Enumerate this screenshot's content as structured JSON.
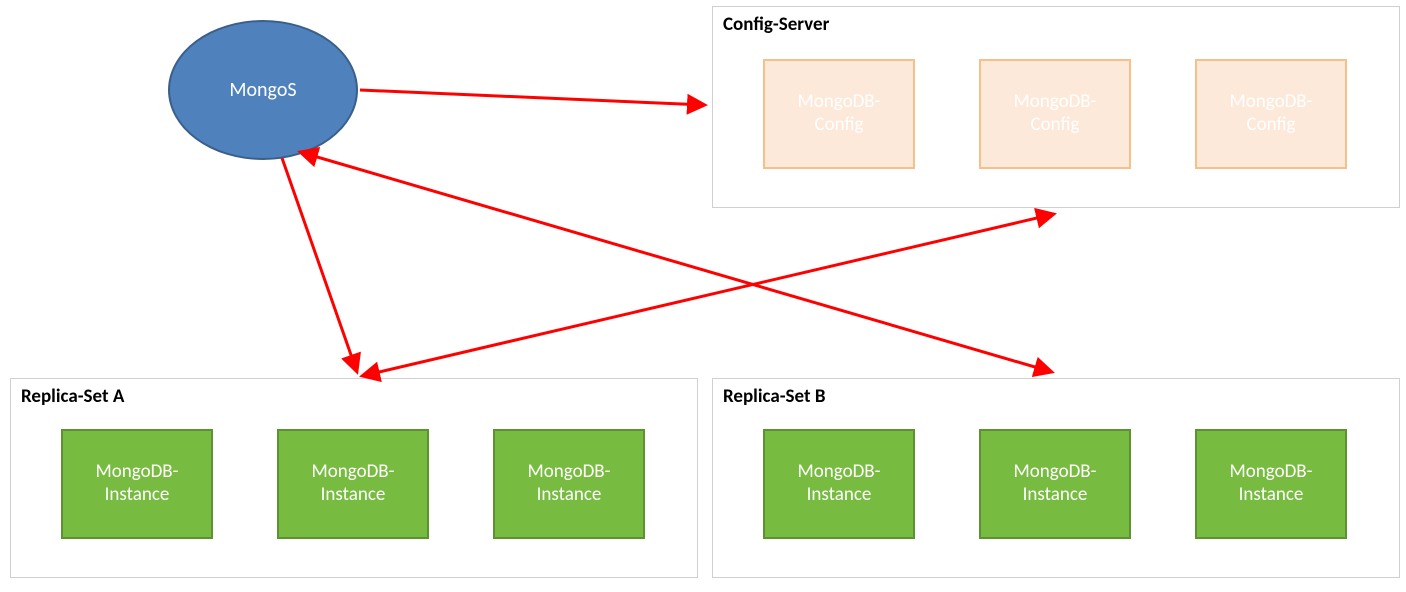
{
  "router": {
    "label": "MongoS"
  },
  "config_server": {
    "title": "Config-Server",
    "nodes": [
      {
        "label": "MongoDB-\nConfig"
      },
      {
        "label": "MongoDB-\nConfig"
      },
      {
        "label": "MongoDB-\nConfig"
      }
    ]
  },
  "replica_sets": [
    {
      "title": "Replica-Set A",
      "nodes": [
        {
          "label": "MongoDB-\nInstance"
        },
        {
          "label": "MongoDB-\nInstance"
        },
        {
          "label": "MongoDB-\nInstance"
        }
      ]
    },
    {
      "title": "Replica-Set B",
      "nodes": [
        {
          "label": "MongoDB-\nInstance"
        },
        {
          "label": "MongoDB-\nInstance"
        },
        {
          "label": "MongoDB-\nInstance"
        }
      ]
    }
  ],
  "arrows": {
    "color": "#ff0000",
    "edges": [
      {
        "from": "mongos",
        "to": "config-server",
        "direction": "uni"
      },
      {
        "from": "mongos",
        "to": "replica-set-a",
        "direction": "uni"
      },
      {
        "from": "mongos",
        "to": "replica-set-b",
        "direction": "bi"
      },
      {
        "from": "replica-set-a",
        "to": "config-server",
        "direction": "bi"
      }
    ]
  }
}
